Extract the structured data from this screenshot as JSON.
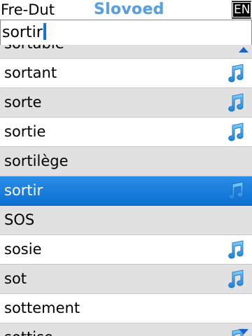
{
  "header": {
    "lang_pair": "Fre-Dut",
    "app_title": "Slovoed",
    "lang_button": "EN"
  },
  "search": {
    "value": "sortir"
  },
  "list": {
    "items": [
      {
        "word": "sortable",
        "audio": false
      },
      {
        "word": "sortant",
        "audio": true
      },
      {
        "word": "sorte",
        "audio": true
      },
      {
        "word": "sortie",
        "audio": true
      },
      {
        "word": "sortilège",
        "audio": false
      },
      {
        "word": "sortir",
        "audio": true,
        "selected": true
      },
      {
        "word": "SOS",
        "audio": false
      },
      {
        "word": "sosie",
        "audio": true
      },
      {
        "word": "sot",
        "audio": true
      },
      {
        "word": "sottement",
        "audio": false
      },
      {
        "word": "sottise",
        "audio": true
      }
    ]
  },
  "colors": {
    "selection": "#1a7ddc",
    "title": "#5aa0dc",
    "note": "#2a9ae0"
  }
}
